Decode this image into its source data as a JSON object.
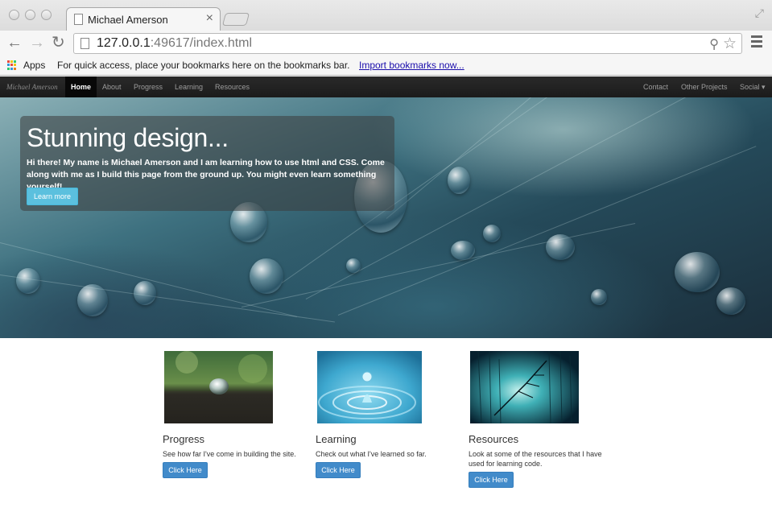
{
  "browser": {
    "tab_title": "Michael Amerson",
    "tab_close": "×",
    "url_host": "127.0.0.1",
    "url_rest": ":49617/index.html",
    "bookmarks": {
      "apps_label": "Apps",
      "hint": "For quick access, place your bookmarks here on the bookmarks bar.",
      "import_link": "Import bookmarks now..."
    }
  },
  "site_nav": {
    "brand": "Michael Amerson",
    "left_items": [
      "Home",
      "About",
      "Progress",
      "Learning",
      "Resources"
    ],
    "active": "Home",
    "right_items": [
      "Contact",
      "Other Projects",
      "Social ▾"
    ]
  },
  "hero": {
    "title": "Stunning design...",
    "text": "Hi there! My name is Michael Amerson and I am learning how to use html and CSS. Come along with me as I build this page from the ground up. You might even learn something yourself!",
    "button": "Learn more"
  },
  "cards": [
    {
      "title": "Progress",
      "desc": "See how far I've come in building the site.",
      "button": "Click Here"
    },
    {
      "title": "Learning",
      "desc": "Check out what I've learned so far.",
      "button": "Click Here"
    },
    {
      "title": "Resources",
      "desc": "Look at some of the resources that I have used for learning code.",
      "button": "Click Here"
    }
  ],
  "colors": {
    "info_button": "#5bc0de",
    "primary_button": "#428bca",
    "navbar": "#222222"
  }
}
